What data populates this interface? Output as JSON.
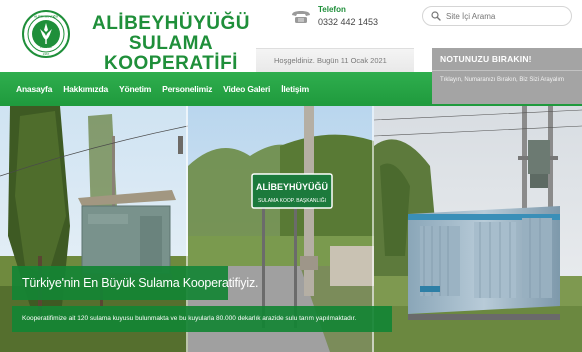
{
  "brand": {
    "line1": "ALİBEYHÜYÜĞÜ",
    "line2": "SULAMA KOOPERATİFİ",
    "seal_top_text": "ALİBEYHÜYÜĞÜ",
    "seal_city": "KONYA",
    "seal_year": "1967"
  },
  "contact": {
    "phone_label": "Telefon",
    "phone_number": "0332 442 1453",
    "phone_icon": "phone-icon"
  },
  "search": {
    "placeholder": "Site İçi Arama",
    "icon": "search-icon"
  },
  "welcome": {
    "text": "Hoşgeldiniz. Bugün 11 Ocak 2021"
  },
  "note_panel": {
    "title": "NOTUNUZU BIRAKIN!",
    "subtitle": "Tıklayın, Numaranızı Bırakın, Biz Sizi Arayalım"
  },
  "nav": {
    "items": [
      "Anasayfa",
      "Hakkımızda",
      "Yönetim",
      "Personelimiz",
      "Video Galeri",
      "İletişim"
    ]
  },
  "hero": {
    "sign_line1": "ALİBEYHÜYÜĞÜ",
    "sign_line2": "SULAMA KOOP. BAŞKANLIĞI",
    "caption_title": "Türkiye'nin En Büyük Sulama Kooperatifiyiz.",
    "caption_text": "Kooperatifimize ait 120 sulama kuyusu bulunmakta ve bu kuyularla 80.000 dekarlık arazide sulu tarım yapılmaktadır."
  },
  "colors": {
    "brand_green": "#1f8f3a",
    "nav_green": "#27a446",
    "note_gray": "#a4a4a4"
  }
}
